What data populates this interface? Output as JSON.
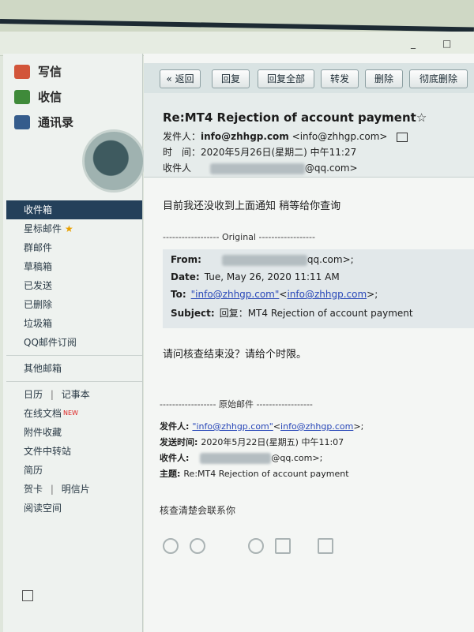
{
  "window": {
    "minimize": "_",
    "maximize": "□"
  },
  "sidebar": {
    "actions": [
      {
        "label": "写信",
        "icon": "compose-icon"
      },
      {
        "label": "收信",
        "icon": "inbox-icon"
      },
      {
        "label": "通讯录",
        "icon": "contacts-icon"
      }
    ],
    "folders": [
      "收件箱",
      "星标邮件",
      "群邮件",
      "草稿箱",
      "已发送",
      "已删除",
      "垃圾箱",
      "QQ邮件订阅"
    ],
    "other": "其他邮箱",
    "tools": {
      "calendar": "日历",
      "notes": "记事本",
      "online_docs": "在线文档",
      "online_docs_badge": "NEW",
      "attachments": "附件收藏",
      "transfer": "文件中转站",
      "resume": "简历",
      "cards": "贺卡",
      "postcards": "明信片",
      "reading": "阅读空间"
    }
  },
  "toolbar": {
    "back": "« 返回",
    "reply": "回复",
    "reply_all": "回复全部",
    "forward": "转发",
    "delete": "删除",
    "perm_delete": "彻底删除"
  },
  "email": {
    "subject": "Re:MT4 Rejection of account payment",
    "sender_label": "发件人：",
    "sender_name": "info@zhhgp.com",
    "sender_addr": "<info@zhhgp.com>",
    "time_label": "时　间：",
    "time_value": "2020年5月26日(星期二) 中午11:27",
    "recipient_label": "收件人",
    "recipient_suffix": "@qq.com>",
    "body1": "目前我还没收到上面通知  稍等给你查询",
    "original_divider": "------------------ Original ------------------",
    "quote": {
      "from_label": "From:",
      "from_suffix": "qq.com>;",
      "date_label": "Date:",
      "date_value": "Tue, May 26, 2020 11:11 AM",
      "to_label": "To:",
      "to_name": "\"info@zhhgp.com\"",
      "to_addr": "info@zhhgp.com",
      "to_suffix": ">;",
      "subject_label": "Subject:",
      "subject_value": "回复：MT4 Rejection of account payment"
    },
    "body2": "请问核查结束没？请给个时限。",
    "orig_divider2": "------------------ 原始邮件 ------------------",
    "fwd": {
      "sender_label": "发件人:",
      "sender_name": "\"info@zhhgp.com\"",
      "sender_addr": "info@zhhgp.com",
      "sender_suffix": ">;",
      "time_label": "发送时间:",
      "time_value": "2020年5月22日(星期五) 中午11:07",
      "to_label": "收件人:",
      "to_suffix": "@qq.com>;",
      "subject_label": "主题:",
      "subject_value": "Re:MT4 Rejection of account payment"
    },
    "body3": "核查清楚会联系你"
  }
}
